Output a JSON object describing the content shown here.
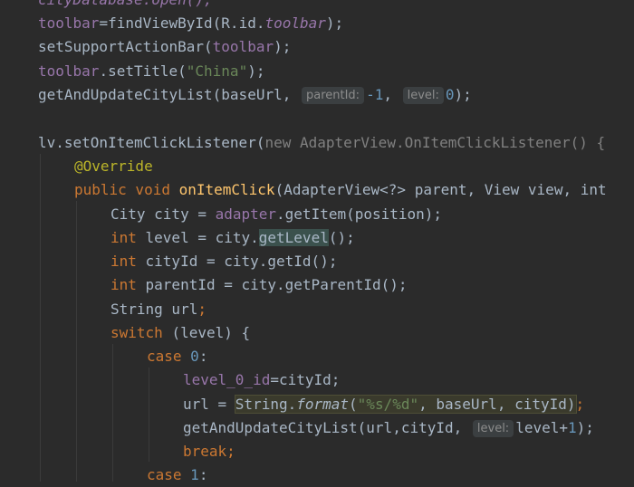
{
  "lines": {
    "l0": "cityDatabase.open();",
    "l1": {
      "a": "toolbar",
      "b": "=findViewById(R.id.",
      "c": "toolbar",
      "d": ");"
    },
    "l2": {
      "a": "setSupportActionBar(",
      "b": "toolbar",
      "c": ");"
    },
    "l3": {
      "a": "toolbar",
      "b": ".setTitle(",
      "c": "\"China\"",
      "d": ");"
    },
    "l4": {
      "a": "getAndUpdateCityList(baseUrl, ",
      "hint1": "parentId:",
      "b": "-1",
      "c": ", ",
      "hint2": "level:",
      "d": "0",
      "e": ");"
    },
    "l6": {
      "a": "lv.setOnItemClickListener(",
      "b": "new AdapterView.OnItemClickListener() {"
    },
    "l7": "@Override",
    "l8": {
      "kw": "public void ",
      "fn": "onItemClick",
      "rest": "(AdapterView<?> parent, View view, int"
    },
    "l9": {
      "a": "City city = ",
      "b": "adapter",
      "c": ".getItem(position);"
    },
    "l10": {
      "kw": "int ",
      "a": "level = city.",
      "b": "getLevel",
      "c": "();"
    },
    "l11": {
      "kw": "int ",
      "a": "cityId = city.getId();"
    },
    "l12": {
      "kw": "int ",
      "a": "parentId = city.getParentId();"
    },
    "l13": {
      "a": "String url",
      "b": ";"
    },
    "l14": {
      "kw": "switch ",
      "a": "(level) {"
    },
    "l15": {
      "kw": "case ",
      "num": "0",
      "a": ":"
    },
    "l16": {
      "a": "level_0_id",
      "b": "=cityId;"
    },
    "l17": {
      "a": "url = ",
      "b": "String.",
      "c": "format",
      "d": "(",
      "e": "\"%s/%d\"",
      "f": ", ",
      "g": "baseUrl",
      "h": ", cityId)",
      "i": ";"
    },
    "l18": {
      "a": "getAndUpdateCityList(url,cityId, ",
      "hint": "level:",
      "b": "level+",
      "c": "1",
      "d": ");"
    },
    "l19": {
      "kw": "break",
      "a": ";"
    },
    "l20": {
      "kw": "case ",
      "num": "1",
      "a": ":"
    }
  },
  "colors": {
    "background": "#2b2b2b",
    "keyword": "#cc7832",
    "method": "#ffc66d",
    "field": "#9876aa",
    "string": "#6a8759",
    "number": "#6897bb",
    "annotation": "#bbb529",
    "default": "#a9b7c6"
  }
}
